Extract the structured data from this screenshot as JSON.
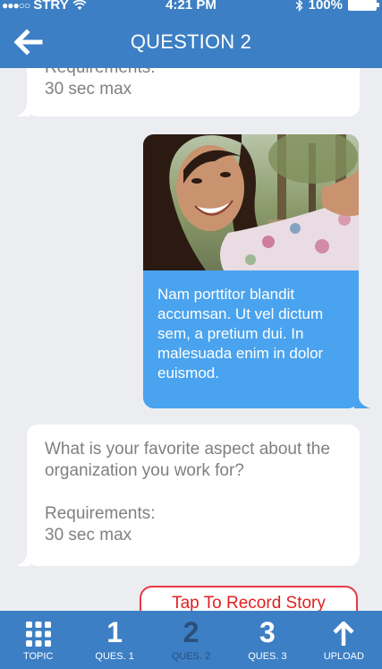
{
  "status_bar": {
    "carrier": "STRY",
    "time": "4:21 PM",
    "battery": "100%"
  },
  "header": {
    "title": "QUESTION 2"
  },
  "messages": {
    "top_partial": {
      "line1": "Requirements:",
      "line2": "30 sec max"
    },
    "reply_text": "Nam porttitor blandit accumsan. Ut vel dictum sem, a pretium dui. In malesuada enim in dolor euismod.",
    "question": {
      "text": "What is your favorite aspect about the organization you work for?",
      "req_line1": "Requirements:",
      "req_line2": "30 sec max"
    }
  },
  "record_button": {
    "label": "Tap To Record Story"
  },
  "tabbar": {
    "items": [
      {
        "num": "",
        "label": "TOPIC",
        "icon": "grid-icon"
      },
      {
        "num": "1",
        "label": "QUES. 1"
      },
      {
        "num": "2",
        "label": "QUES. 2"
      },
      {
        "num": "3",
        "label": "QUES. 3"
      },
      {
        "num": "",
        "label": "UPLOAD",
        "icon": "upload-arrow-icon"
      }
    ]
  },
  "colors": {
    "primary": "#3c7fc4",
    "outgoing_bubble": "#4aa3ee",
    "record_red": "#e02020",
    "active_tab": "#2c4f7a"
  }
}
